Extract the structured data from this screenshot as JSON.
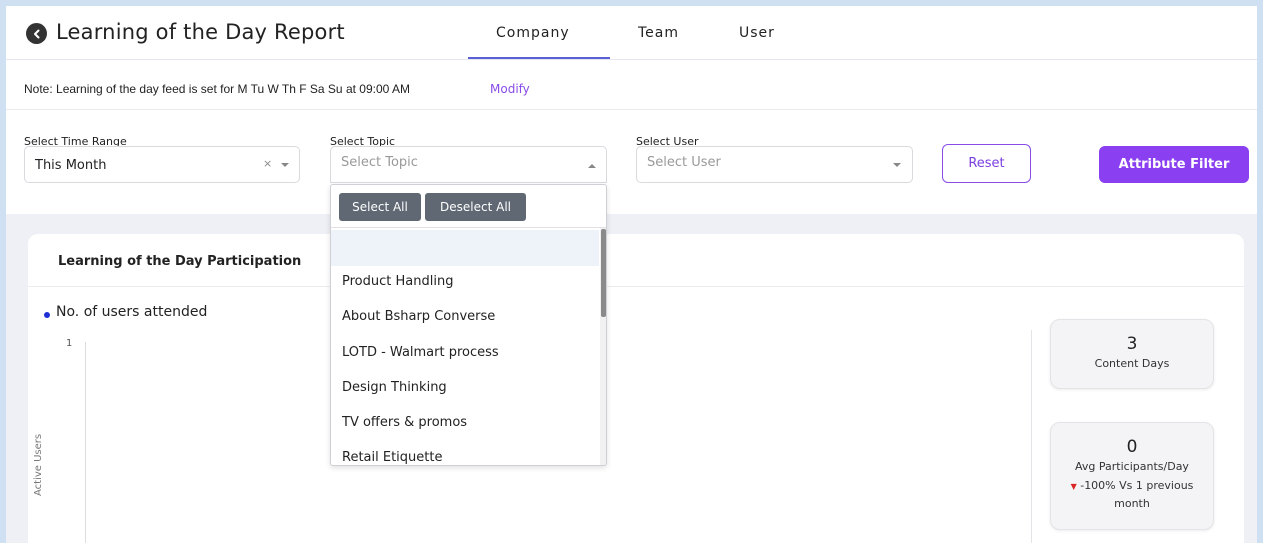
{
  "header": {
    "title": "Learning of the Day Report",
    "tabs": [
      {
        "label": "Company",
        "active": true
      },
      {
        "label": "Team",
        "active": false
      },
      {
        "label": "User",
        "active": false
      }
    ]
  },
  "note": {
    "text": "Note: Learning of the day feed is set for M Tu W Th F Sa Su at 09:00 AM",
    "link": "Modify"
  },
  "filters": {
    "time_range": {
      "label": "Select Time Range",
      "value": "This Month",
      "clear": "×"
    },
    "topic": {
      "label": "Select Topic",
      "placeholder": "Select Topic"
    },
    "user": {
      "label": "Select User",
      "placeholder": "Select User"
    },
    "reset_label": "Reset",
    "attribute_filter_label": "Attribute Filter"
  },
  "topic_dropdown": {
    "select_all": "Select All",
    "deselect_all": "Deselect All",
    "items": [
      "Product Handling",
      "About Bsharp Converse",
      "LOTD - Walmart process",
      "Design Thinking",
      "TV offers & promos",
      "Retail Etiquette"
    ]
  },
  "participation": {
    "title": "Learning of the Day Participation",
    "legend": "No. of users attended",
    "y_tick": "1",
    "y_axis_label": "Active Users"
  },
  "stats": {
    "content_days": {
      "value": "3",
      "label": "Content Days"
    },
    "avg_participants": {
      "value": "0",
      "label": "Avg Participants/Day",
      "change": "-100% Vs 1 previous month"
    }
  },
  "colors": {
    "accent": "#8a3ff0",
    "tab_underline": "#5a5fd6",
    "legend_dot": "#1f2fd6",
    "negative": "#d92424"
  }
}
